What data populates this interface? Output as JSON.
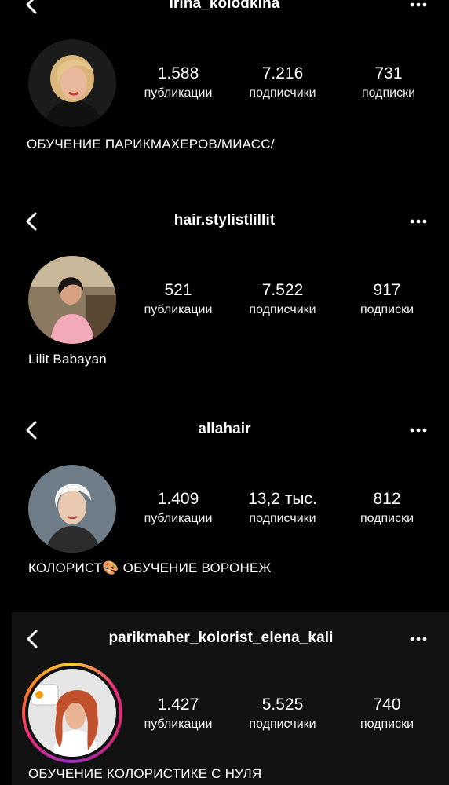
{
  "profiles": [
    {
      "username": "irina_kolodkina",
      "stats": [
        {
          "value": "1.588",
          "label": "публикации"
        },
        {
          "value": "7.216",
          "label": "подписчики"
        },
        {
          "value": "731",
          "label": "подписки"
        }
      ],
      "bio": "ОБУЧЕНИЕ ПАРИКМАХЕРОВ/МИАСС/"
    },
    {
      "username": "hair.stylistlillit",
      "stats": [
        {
          "value": "521",
          "label": "публикации"
        },
        {
          "value": "7.522",
          "label": "подписчики"
        },
        {
          "value": "917",
          "label": "подписки"
        }
      ],
      "bio": "Lilit Babayan"
    },
    {
      "username": "allahair",
      "stats": [
        {
          "value": "1.409",
          "label": "публикации"
        },
        {
          "value": "13,2 тыс.",
          "label": "подписчики"
        },
        {
          "value": "812",
          "label": "подписки"
        }
      ],
      "bio": "КОЛОРИСТ🎨 ОБУЧЕНИЕ ВОРОНЕЖ"
    },
    {
      "username": "parikmaher_kolorist_elena_kali",
      "stats": [
        {
          "value": "1.427",
          "label": "публикации"
        },
        {
          "value": "5.525",
          "label": "подписчики"
        },
        {
          "value": "740",
          "label": "подписки"
        }
      ],
      "bio": "ОБУЧЕНИЕ КОЛОРИСТИКЕ С НУЛЯ"
    }
  ],
  "icons": {
    "back": "chevron-left-icon",
    "more": "more-horizontal-icon",
    "avatar": "avatar-photo"
  }
}
